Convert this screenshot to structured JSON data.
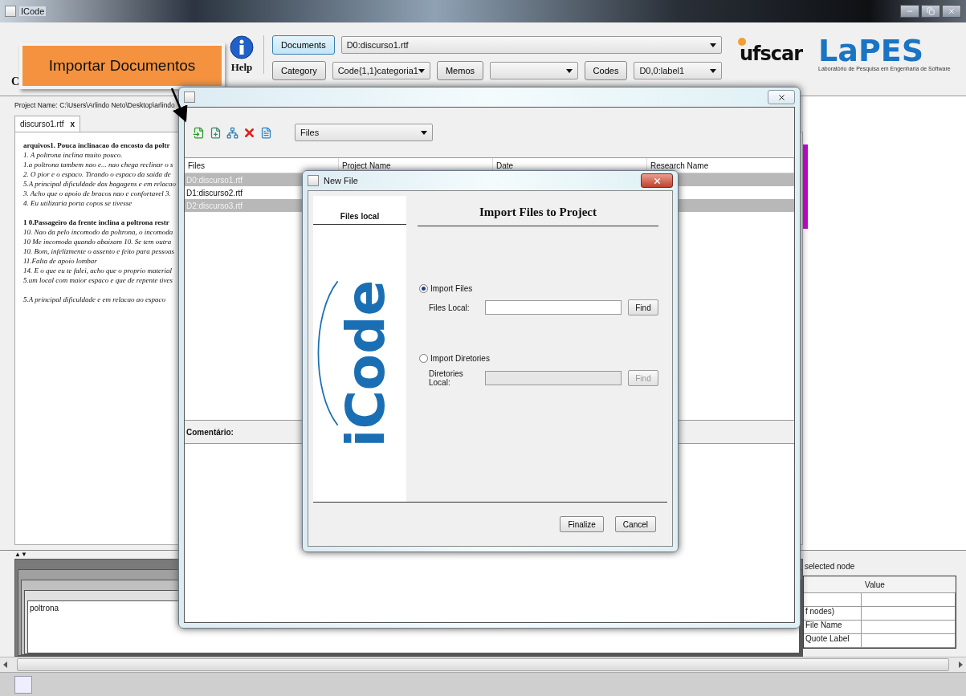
{
  "window": {
    "title": "ICode"
  },
  "toolbar": {
    "partial_label": "C",
    "help_label": "Help",
    "selectors": [
      {
        "button": "Documents",
        "selected": true,
        "value": "D0:discurso1.rtf"
      },
      {
        "button": "Category",
        "selected": false,
        "value": "Code{1,1}categoria1"
      },
      {
        "button": "Memos",
        "selected": false
      },
      {
        "button": "Codes",
        "selected": false,
        "value": "D0,0:label1"
      }
    ]
  },
  "logos": {
    "ufscar": "ufscar",
    "lapes": "LaPES",
    "lapes_caption": "Laboratório de Pesquisa em Engenharia de Software"
  },
  "callout": {
    "text": "Importar Documentos"
  },
  "document_panel": {
    "project_name": "Project Name: C:\\Users\\Arlindo Neto\\Desktop\\arlindo",
    "tabs": [
      {
        "label": "discurso1.rtf",
        "close": "x",
        "selected": true
      }
    ],
    "lines": [
      {
        "kind": "bold",
        "text": "arquivos1. Pouca inclinacao do encosto da poltr"
      },
      {
        "kind": "italic",
        "text": "1. A poltrona inclina muito pouco."
      },
      {
        "kind": "italic",
        "text": "1.a poltrona tambem nao e... nao chega reclinar o s"
      },
      {
        "kind": "italic",
        "text": "2. O pior e o espaco. Tirando o espaco da saida de"
      },
      {
        "kind": "italic",
        "text": "5.A principal dificuldade das bagagens e em relacao"
      },
      {
        "kind": "italic",
        "text": "3. Acho que o apoio de bracos nao e confortavel 3."
      },
      {
        "kind": "italic",
        "text": "4. Eu utilizaria porta copos se tivesse"
      },
      {
        "kind": "bold",
        "gap_before": true,
        "text": "1 0.Passageiro da frente inclina a poltrona restr"
      },
      {
        "kind": "italic",
        "text": "10. Nao da pelo incomodo da poltrona, o incomoda"
      },
      {
        "kind": "italic",
        "text": "10 Me incomoda quando abaixam 10. Se tem outra"
      },
      {
        "kind": "italic",
        "text": "10. Bom, infelizmente o assento e feito para pessoas"
      },
      {
        "kind": "italic",
        "text": "11.Falta de apoio lombar"
      },
      {
        "kind": "italic",
        "text": "14. E o que eu te falei, acho que o proprio material"
      },
      {
        "kind": "italic",
        "text": "5.um local com maior espaco e que de repente tives"
      },
      {
        "kind": "italic",
        "gap_before": true,
        "text": "5.A principal dificuldade e em relacao ao espaco"
      }
    ]
  },
  "bottom_panel": {
    "splitter_arrows": "▲▼",
    "node_text": "poltrona",
    "properties": {
      "title": "selected node",
      "columns": [
        "Value"
      ],
      "rows": [
        "f nodes)",
        "File Name",
        "Quote Label"
      ]
    }
  },
  "import_dialog": {
    "view_select": "Files",
    "table": {
      "columns": [
        "Files",
        "Project Name",
        "Date",
        "Research Name"
      ],
      "rows": [
        {
          "file": "D0:discurso1.rtf",
          "selected": true
        },
        {
          "file": "D1:discurso2.rtf",
          "selected": false
        },
        {
          "file": "D2:discurso3.rtf",
          "selected": true
        }
      ]
    },
    "comment_label": "Comentário:"
  },
  "new_file_dialog": {
    "title": "New File",
    "side_label": "Files local",
    "logo_text": "iCode",
    "heading": "Import Files to Project",
    "options": [
      {
        "label": "Import Files",
        "selected": true,
        "field_label": "Files Local:",
        "button": "Find",
        "disabled": false
      },
      {
        "label": "Import Diretories",
        "selected": false,
        "field_label": "Diretories Local:",
        "button": "Find",
        "disabled": true
      }
    ],
    "buttons": [
      "Finalize",
      "Cancel"
    ]
  }
}
